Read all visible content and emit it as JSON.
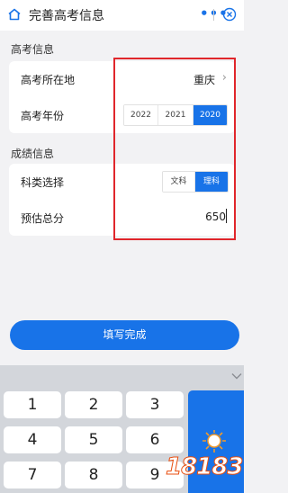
{
  "header": {
    "title": "完善高考信息",
    "more_icon": "•••",
    "close_icon": "close-circle-icon"
  },
  "section_exam": {
    "title": "高考信息",
    "location": {
      "label": "高考所在地",
      "value": "重庆",
      "chevron": "›"
    },
    "year": {
      "label": "高考年份",
      "options": [
        "2022",
        "2021",
        "2020"
      ],
      "selected": "2020"
    }
  },
  "section_score": {
    "title": "成绩信息",
    "subject": {
      "label": "科类选择",
      "options": [
        "文科",
        "理科"
      ],
      "selected": "理科"
    },
    "score": {
      "label": "预估总分",
      "value": "650"
    }
  },
  "submit_label": "填写完成",
  "keyboard": {
    "keys": [
      "1",
      "2",
      "3",
      "4",
      "5",
      "6",
      "7",
      "8",
      "9"
    ]
  },
  "watermark": {
    "text": "18183"
  },
  "colors": {
    "accent": "#1873e8",
    "highlight": "#e0262b"
  }
}
